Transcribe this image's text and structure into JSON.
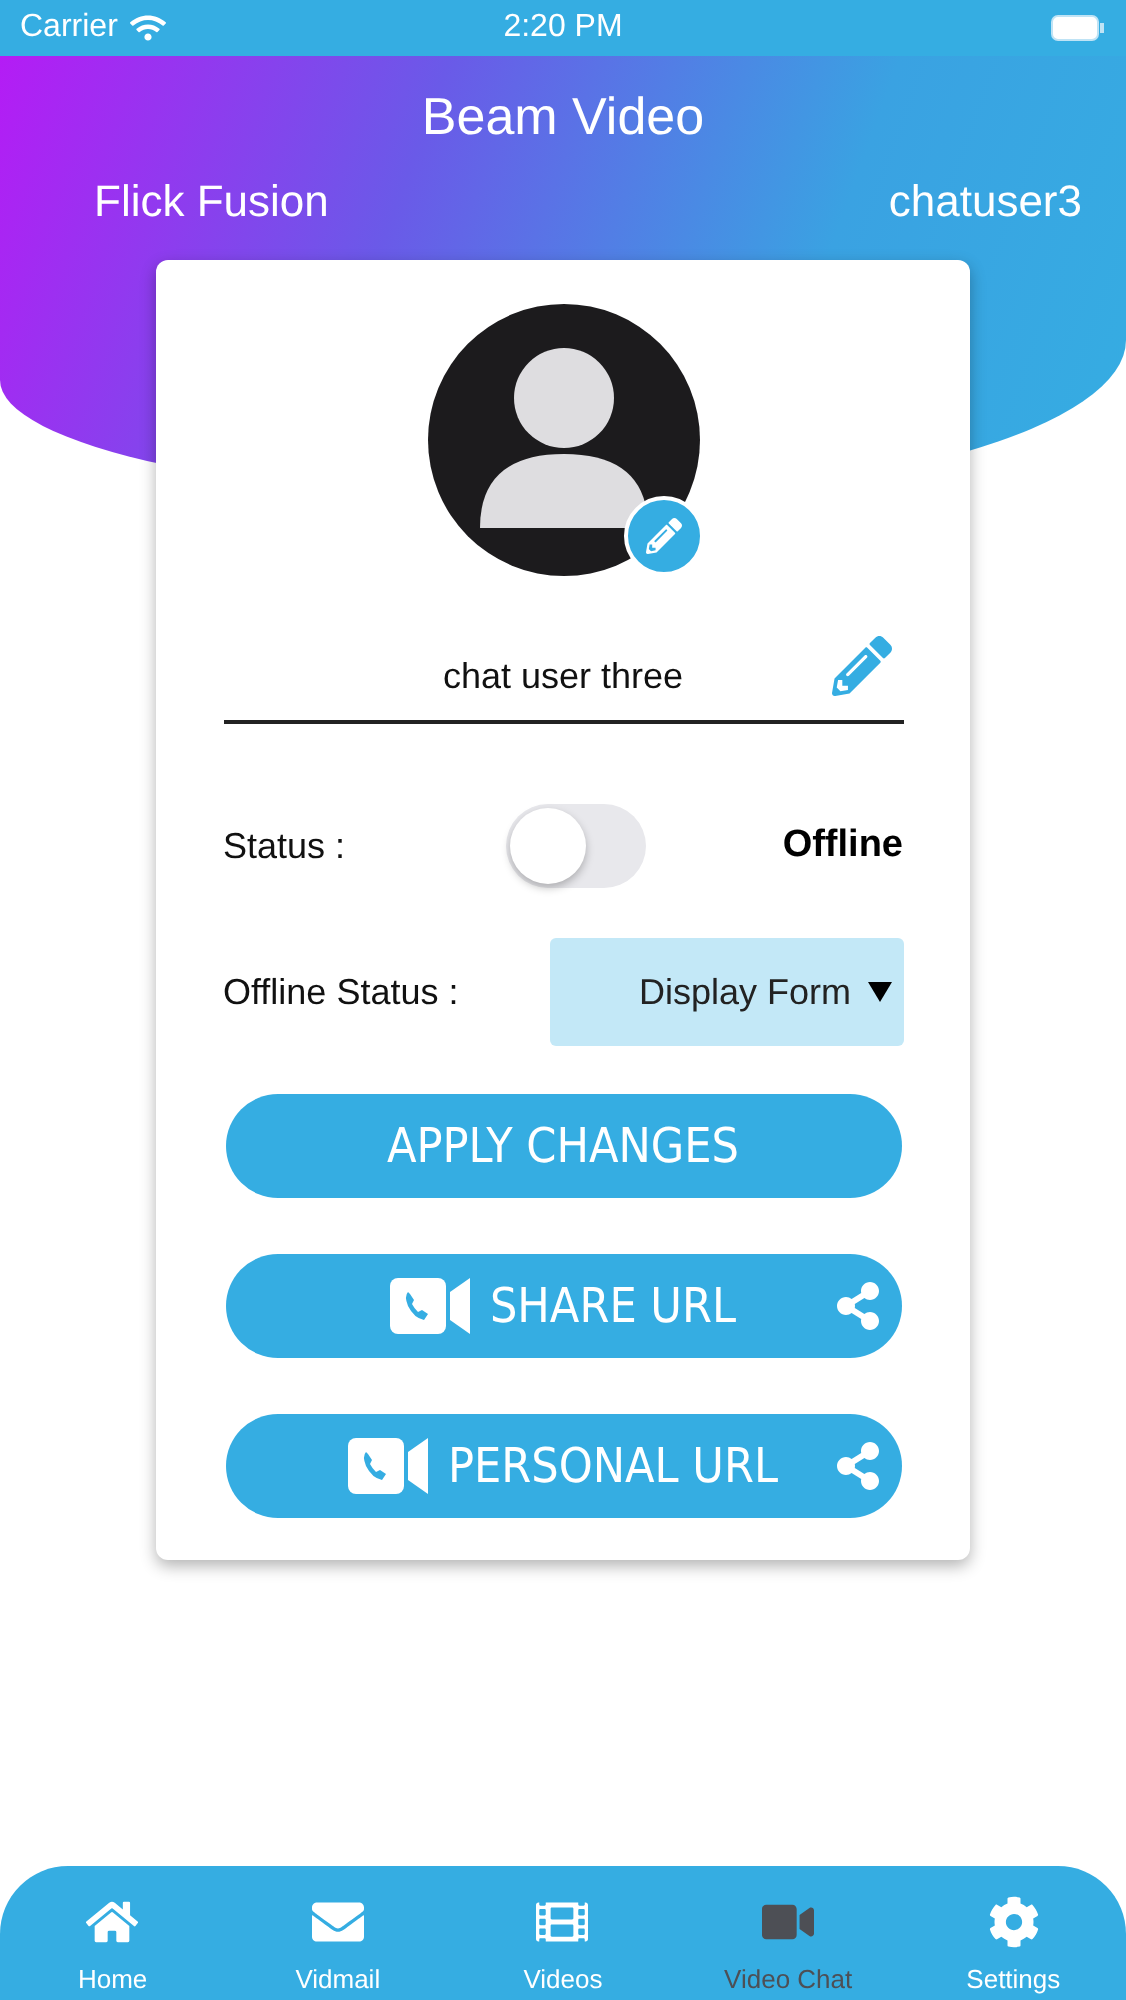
{
  "status_bar": {
    "carrier": "Carrier",
    "time": "2:20 PM"
  },
  "header": {
    "title": "Beam Video",
    "left_label": "Flick Fusion",
    "right_label": "chatuser3"
  },
  "profile": {
    "name": "chat user three"
  },
  "status": {
    "label": "Status :",
    "on": false,
    "value": "Offline"
  },
  "offline_status": {
    "label": "Offline Status :",
    "value": "Display Form"
  },
  "buttons": [
    {
      "kind": "plain",
      "label": "APPLY CHANGES"
    },
    {
      "kind": "share",
      "label": "SHARE URL"
    },
    {
      "kind": "share",
      "label": "PERSONAL URL"
    }
  ],
  "tabs": [
    {
      "kind": "home",
      "label": "Home",
      "selected": false
    },
    {
      "kind": "mail",
      "label": "Vidmail",
      "selected": false
    },
    {
      "kind": "videos",
      "label": "Videos",
      "selected": false
    },
    {
      "kind": "chat",
      "label": "Video Chat",
      "selected": true
    },
    {
      "kind": "settings",
      "label": "Settings",
      "selected": false
    }
  ]
}
